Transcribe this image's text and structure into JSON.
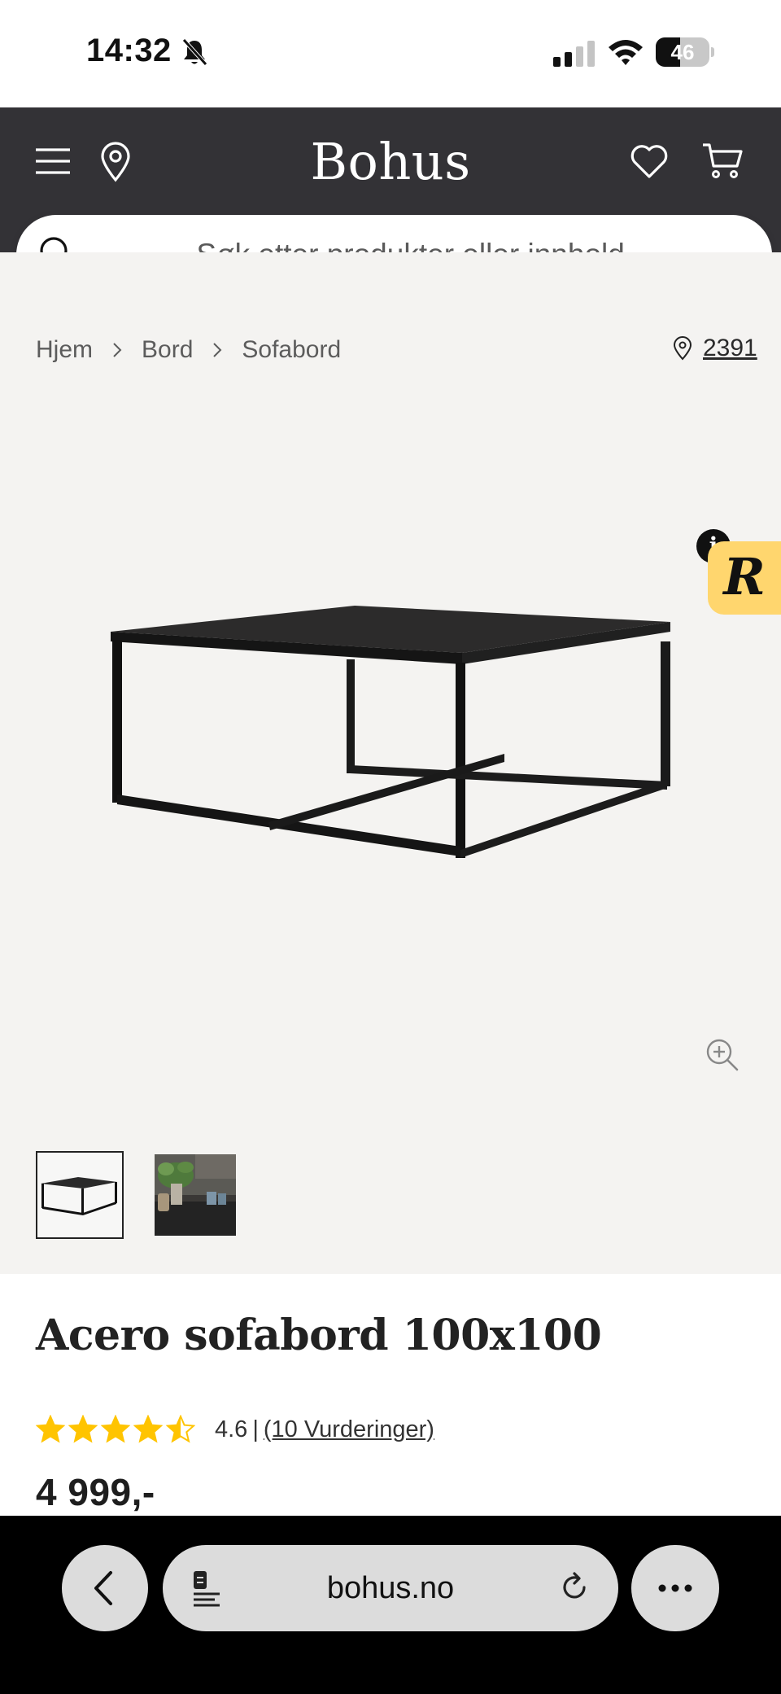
{
  "status_bar": {
    "time": "14:32",
    "battery_level": "46"
  },
  "header": {
    "logo": "Bohus"
  },
  "search": {
    "placeholder": "Søk etter produkter eller innhold..."
  },
  "breadcrumb": {
    "items": [
      "Hjem",
      "Bord",
      "Sofabord"
    ]
  },
  "store": {
    "code": "2391"
  },
  "badge": {
    "letter": "R",
    "info": "i"
  },
  "product": {
    "title": "Acero sofabord 100x100",
    "rating": {
      "value": "4.6",
      "separator": "|",
      "count_text": "(10 Vurderinger)",
      "stars_filled": 4.5,
      "stars_total": 5
    },
    "price": "4 999,-"
  },
  "browser": {
    "url": "bohus.no"
  },
  "colors": {
    "header_bg": "#333236",
    "gallery_bg": "#f4f3f1",
    "star": "#ffc400",
    "badge": "#ffd66e"
  }
}
